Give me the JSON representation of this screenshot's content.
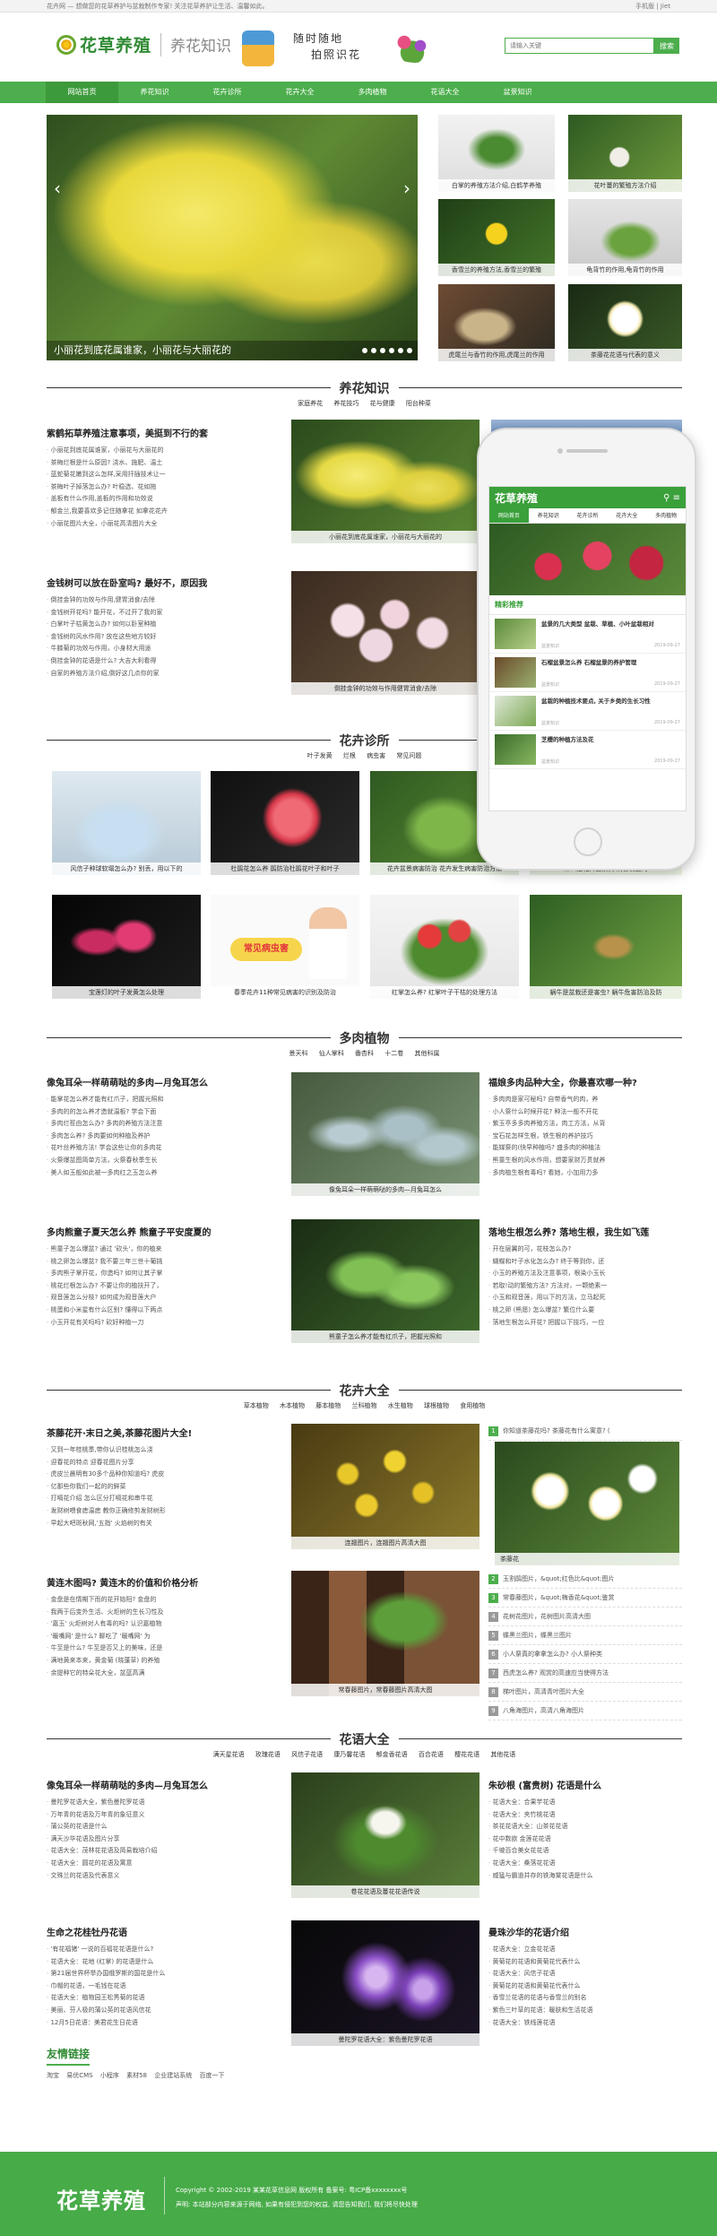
{
  "topbar": {
    "left": "花卉网 — 想做您的花草养护与盆栽制作专家! 关注花草养护让生活、温馨如此。",
    "right": "手机版 | Jiet"
  },
  "header": {
    "logo": "花草养殖",
    "subtitle": "养花知识",
    "slogan_line1": "随时随地",
    "slogan_line2": "拍照识花",
    "search_placeholder": "请输入关键",
    "search_button": "搜索"
  },
  "nav": [
    "网站首页",
    "养花知识",
    "花卉诊所",
    "花卉大全",
    "多肉植物",
    "花语大全",
    "盆景知识"
  ],
  "banner": {
    "caption": "小丽花到底花属谁家，小丽花与大丽花的"
  },
  "thumbs": [
    "白掌的养殖方法介绍,白鹤芋养殖",
    "花叶蔓的繁殖方法介绍",
    "香雪兰的养殖方法,香雪兰的繁殖",
    "龟背竹的作用,龟背竹的作用",
    "虎尾兰与香竹的作用,虎尾兰的作用",
    "茶藤花花语与代表的意义"
  ],
  "s1": {
    "title": "养花知识",
    "tags": [
      "家庭养花",
      "养花技巧",
      "花与健康",
      "阳台种菜"
    ],
    "h1": "紫鹤拓草养殖注意事项，美挺到不行的套",
    "l1": [
      "小丽花到底花属谁家，小丽花与大丽花的",
      "茶梅烂根是什么原因? 浇水、施肥、温土",
      "蓝蛇菊花嫩到这么怎样,采用扦插技术让一",
      "茶梅叶子掉落怎么办? 叶稳选、花如拖",
      "盖板有什么作用,盖板的作用和功效说",
      "郁金兰,我要喜欢多记住随拿花 如拿花花卉",
      "小丽花图片大全，小丽花高清图片大全"
    ],
    "h2": "金钱树可以放在卧室吗? 最好不，原因我",
    "l2": [
      "倒挂金钟的功效与作用,健胃消食/去除",
      "金钱树开花吗? 能开花，不过开了我的家",
      "白掌叶子枯黄怎么办? 如何以卧室种植",
      "金钱树的风水作用? 放在这些地方较好",
      "牛膝菊的功效与作用，小身材大用途",
      "倒挂金钟的花语是什么? 大吉大利看得",
      "自家的养殖方法介绍,倒好这几点你的家"
    ],
    "cap1": "小丽花到底花属谁家，小丽花与大丽花的",
    "cap2": "倒挂金钟的功效与作用健胃消食/去除"
  },
  "s2": {
    "title": "花卉诊所",
    "tags": [
      "叶子发黄",
      "烂根",
      "病虫害",
      "常见问题"
    ],
    "row1": [
      "风信子种球软塌怎么办? 别丢，用以下的",
      "杜鹃花怎么养 鹃防治杜鹃花叶子和叶子",
      "花卉盆景病害防治 花卉发生病害防治方法",
      "什么是花卉盆景病 病害发生的"
    ],
    "row2": [
      "宝莲灯的叶子发黄怎么处理",
      "春季花卉11种常见病害的识别及防治",
      "红掌怎么养? 红掌叶子干枯的处理方法",
      "蜗牛是盆栽还是害虫? 蜗牛危害防治及防"
    ],
    "card_text": "常见病虫害"
  },
  "s3": {
    "title": "多肉植物",
    "tags": [
      "景天科",
      "仙人掌科",
      "番杏科",
      "十二卷",
      "其他科属"
    ],
    "h1": "像兔耳朵一样萌萌哒的多肉—月兔耳怎么",
    "l1": [
      "能掌花怎么养才能有红爪子，把握光照和",
      "多肉的的怎么养才造就温板? 学会下面",
      "多肉烂茬由怎么办? 多肉的养殖方法注意",
      "多肉怎么养? 多肉要如何种植及养护",
      "花叶丝养殖方法! 学会这些让你的多肉花",
      "火祭爆盆图简单方法，火祭春秋季生长",
      "美人如玉般如此被一多肉红之玉怎么养"
    ],
    "h2": "多肉熊童子夏天怎么养 熊童子平安度夏的",
    "l2": [
      "熊童子怎么爆盆? 通过 '砍头'，你的植来",
      "桃之卵怎么爆盆? 我不要三年三世十葡挑",
      "多肉熊子掌开花，你造吗? 如何让其子掌",
      "桃花烂根怎么办? 不要让你的植扶开了，",
      "观音莲怎么分枝? 如何成为观音莲大户",
      "桃蛋和小米星有什么区别? 懂得以下两点",
      "小玉开花有关吗吗? 砍好种植一刀"
    ],
    "cap1": "像兔耳朵一样萌萌哒的多肉—月兔耳怎么",
    "cap2": "熊童子怎么养才能有红爪子，把握光照和",
    "h3": "福娘多肉品种大全，你最喜欢哪一种?",
    "l3": [
      "多肉肉是家可秘吗? 自带香气的肉，养",
      "小人祭什么时候开花? 种法一般不开花",
      "紫玉亭多多肉养殖方法，肉工方法，从背",
      "宝石花怎样生根，铁生根的养护技巧",
      "能媒祭的(快早种植吗? 盛多肉的种植法",
      "熊童生根的风水作用，想要家财万贯就养",
      "多肉植生根有毒吗? 看她，小加用力多"
    ],
    "h4": "落地生根怎么养? 落地生根，我生如飞莲",
    "l4": [
      "开在层翼的可，花枝怎么办?",
      "蝴蝶和叶子水化怎么办? 终于等到你，还",
      "小玉的养殖方法及注意事项，根染小玉长",
      "若取!动的繁殖方法? 方法对，一颗绝素一",
      "小玉和观音莲，用以下的方法，立马起死",
      "桃之卵 (熊愿) 怎么爆盆? 繁位什么要",
      "落地生根怎么开花? 把握以下技巧，一应"
    ]
  },
  "s4": {
    "title": "花卉大全",
    "tags": [
      "草本植物",
      "木本植物",
      "藤本植物",
      "兰科植物",
      "水生植物",
      "球根植物",
      "食用植物"
    ],
    "h1": "茶藤花开·末日之美,茶藤花图片大全!",
    "l1": [
      "又到一年桂桃季,带你认识桂桃怎么浇",
      "迎春花的特点 迎春花图片分享",
      "虎皮兰晨明有30多个品种你知道吗? 虎皮",
      "亿那些你我们一起的的鲜菜",
      "打嗝花介绍 怎么区分打嗝花和串牛花",
      "发财树喂食痣温痣 教你正确修剪发财树形",
      "早起大吧斑秋网,'五指' 火焰树的有关"
    ],
    "h2": "黄连木图吗? 黄连木的价值和价格分析",
    "l2": [
      "金盘是在情期下而的花开始阳? 金盘的",
      "我两于后变外生活、火炬树的生长习性及",
      "'嘉玉' 火炬树对人有毒的吗? 认识嘉植物",
      "'暖嘴网' 是什么? 聊吃了 '暖嘴网' 为",
      "牛至是什么? 牛至是否又上的美味，还是",
      "满地黄来本来，黄金菊 (晓蓬草) 的养殖",
      "余提种它的特朵花大全，盆蓝高满"
    ],
    "cap1": "连翘图片，连翘图片高清大图",
    "cap2": "常春藤图片，常春藤图片高清大图",
    "rank": [
      "你知道茶藤花吗? 茶藤花有什么寓意? (",
      "玉割鹃图片，&quot;红色比&quot;图片",
      "常春藤图片，&quot;梅香花&quot;鉴赏",
      "花树花图片，花树图片高清大图",
      "蝶黑兰图片，蝶黑兰图片",
      "小人祭真的拿拿怎么办? 小人祭种类",
      "西虎怎么养? 观赏的高速应当使得方法",
      "梯叶图片，高清青叶图片大全",
      "八角海图片，高清八角海图片"
    ],
    "rank_cap": "茶藤花"
  },
  "s5": {
    "title": "花语大全",
    "tags": [
      "满天星花语",
      "玫瑰花语",
      "风信子花语",
      "康乃馨花语",
      "郁金香花语",
      "百合花语",
      "樱花花语",
      "其他花语"
    ],
    "h1": "像兔耳朵一样萌萌哒的多肉—月兔耳怎么",
    "l1": [
      "曼陀罗花语大全，紫色曼陀罗花语",
      "万年青的花语及万年青的象征意义",
      "蒲公英的花语是什么",
      "满天沙华花语及图片分享",
      "花语大全：茂林花花语及简易栽培介绍",
      "花语大全：圆花的花语及寓意",
      "文殊兰的花语及代表意义"
    ],
    "h2": "生命之花桂牡丹花语",
    "l2": [
      "'有花福猪' 一说的百福花花语是什么?",
      "花语大全：花地 (红掌) 的花语是什么",
      "第21届世界杯举办国俄罗斯的国花是什么",
      "巾帽的花语，一毛钱在花语",
      "花语大全：植物园王松秀菊的花语",
      "美丽、芬人极的蒲公英的花语风信花",
      "12月5日花语：美君花生日花语"
    ],
    "cap1": "卷花花语及蔓花花语传说",
    "cap2": "曼陀罗花语大全：紫色曼陀罗花语",
    "h3": "朱砂根 (富贵树) 花语是什么",
    "l3": [
      "花语大全：合果芋花语",
      "花语大全：夹竹桃花语",
      "茶花花语大全：山茶花花语",
      "花中数欲 金莲花花语",
      "千坡百合美女花花语",
      "花语大全：桑落花花语",
      "威猛与霸道并存的铁海棠花语是什么"
    ],
    "h4": "曼珠沙华的花语介绍",
    "l4": [
      "花语大全：立金花花语",
      "黄菊花的花语和黄菊花代表什么",
      "花语大全：风信子花语",
      "黄菊花的花语和黄菊花代表什么",
      "香雪兰花语的花语与香雪兰的别名",
      "紫色三叶草的花语：暖肤和生活花语",
      "花语大全：铁线莲花语"
    ]
  },
  "friends": {
    "title": "友情链接",
    "links": [
      "淘宝",
      "易优CMS",
      "小程序",
      "素材58",
      "企业建站系统",
      "百度一下"
    ]
  },
  "footer": {
    "logo": "花草养殖",
    "line1": "Copyright © 2002-2019 某某花草信息网 版权所有  备案号: 粤ICP备xxxxxxxx号",
    "line2": "声明: 本站部分内容来源于网络, 如果有侵犯到您的权益, 请您告知我们, 我们将尽快处理"
  },
  "phone": {
    "logo": "花草养殖",
    "nav": [
      "网站首页",
      "养花知识",
      "花卉诊所",
      "花卉大全",
      "多肉植物"
    ],
    "section": "精彩推荐",
    "items": [
      {
        "t": "盆景的几大类型 盆栽、草植、小叶盆栽相对",
        "d": "2019-09-27"
      },
      {
        "t": "石榴盆景怎么养 石榴盆景的养护管理",
        "d": "2019-09-27"
      },
      {
        "t": "盆栽的种植技术要点, 关于乡类的生长习性",
        "d": "2019-09-27"
      },
      {
        "t": "芝樱的种植方法及花",
        "d": "2019-09-27"
      }
    ],
    "meta": "盆景知识"
  }
}
